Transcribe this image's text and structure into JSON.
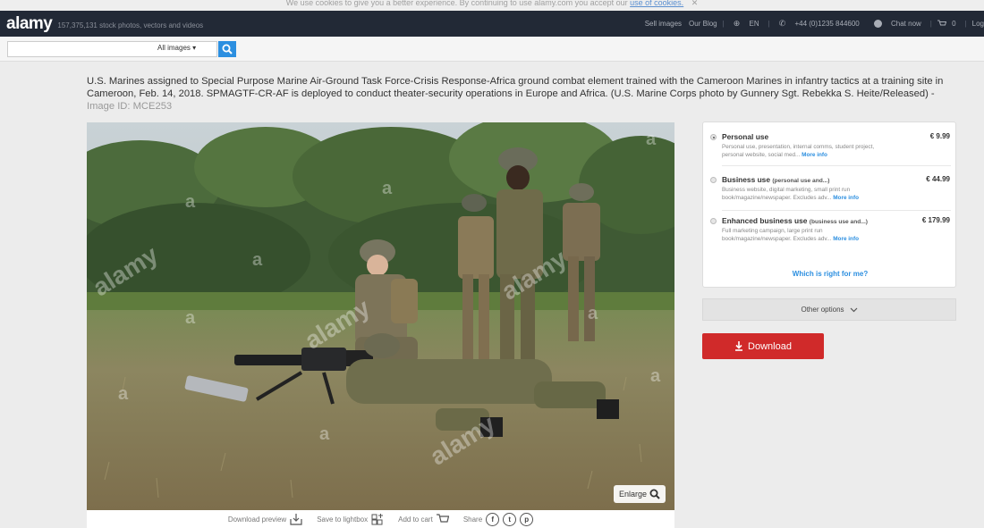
{
  "cookie": {
    "text": "We use cookies to give you a better experience. By continuing to use alamy.com you accept our",
    "link": "use of cookies.",
    "close": "✕"
  },
  "header": {
    "logo": "alamy",
    "tagline": "157,375,131 stock photos, vectors and videos",
    "nav": {
      "sell": "Sell images",
      "blog": "Our Blog",
      "lang": "EN",
      "phone": "+44 (0)1235 844600",
      "chat": "Chat now",
      "cart_count": "0",
      "login": "Log"
    }
  },
  "search": {
    "placeholder": "",
    "filter": "All images"
  },
  "image": {
    "caption": "U.S. Marines assigned to Special Purpose Marine Air-Ground Task Force-Crisis Response-Africa ground combat element trained with the Cameroon Marines in infantry tactics at a training site in Cameroon, Feb. 14, 2018. SPMAGTF-CR-AF is deployed to conduct theater-security operations in Europe and Africa. (U.S. Marine Corps photo by Gunnery Sgt. Rebekka S. Heite/Released) -",
    "id_label": "Image ID:",
    "id": "MCE253",
    "watermark": "alamy",
    "watermark_a": "a",
    "enlarge": "Enlarge"
  },
  "actions": {
    "preview": "Download preview",
    "lightbox": "Save to lightbox",
    "cart": "Add to cart",
    "share": "Share"
  },
  "licenses": {
    "options": [
      {
        "title": "Personal use",
        "sub": "",
        "price": "€ 9.99",
        "desc": "Personal use, presentation, internal comms, student project, personal website, social med...",
        "more": "More info",
        "selected": true
      },
      {
        "title": "Business use",
        "sub": "(personal use and...)",
        "price": "€ 44.99",
        "desc": "Business website, digital marketing, small print run book/magazine/newspaper. Excludes adv...",
        "more": "More info",
        "selected": false
      },
      {
        "title": "Enhanced business use",
        "sub": "(business use and...)",
        "price": "€ 179.99",
        "desc": "Full marketing campaign, large print run book/magazine/newspaper. Excludes adv...",
        "more": "More info",
        "selected": false
      }
    ],
    "which": "Which is right for me?",
    "other": "Other options",
    "download": "Download"
  },
  "colors": {
    "accent": "#2c8fe0",
    "download": "#d02a2a",
    "topbar": "#222936"
  }
}
